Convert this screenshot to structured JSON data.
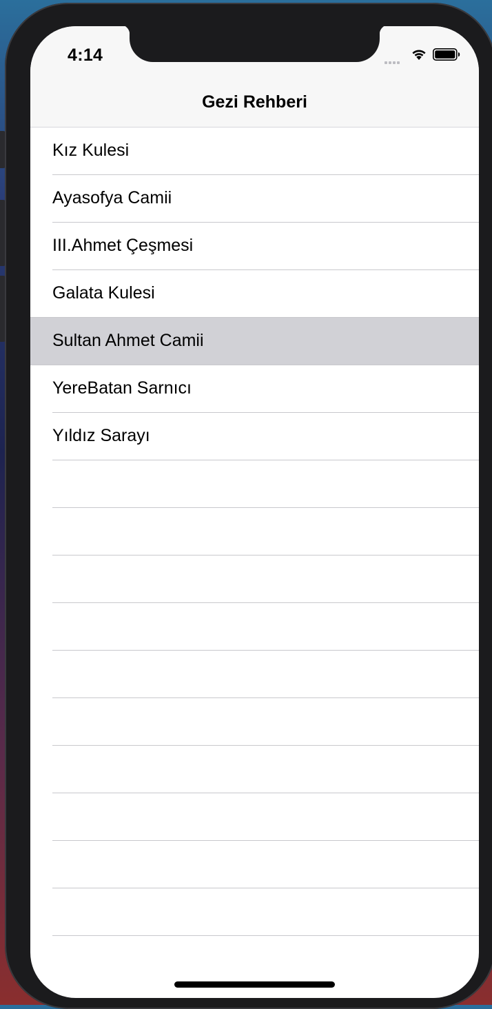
{
  "status_bar": {
    "time": "4:14"
  },
  "nav": {
    "title": "Gezi Rehberi"
  },
  "places": [
    {
      "label": "Kız Kulesi"
    },
    {
      "label": "Ayasofya Camii"
    },
    {
      "label": "III.Ahmet Çeşmesi"
    },
    {
      "label": "Galata Kulesi"
    },
    {
      "label": "Sultan Ahmet Camii",
      "selected": true
    },
    {
      "label": "YereBatan Sarnıcı"
    },
    {
      "label": "Yıldız Sarayı"
    }
  ],
  "empty_row_count": 10,
  "colors": {
    "selected_row": "#d1d1d6",
    "nav_background": "#f7f7f7",
    "separator": "#c8c8cc"
  },
  "icons": [
    "signal-icon",
    "wifi-icon",
    "battery-icon"
  ]
}
